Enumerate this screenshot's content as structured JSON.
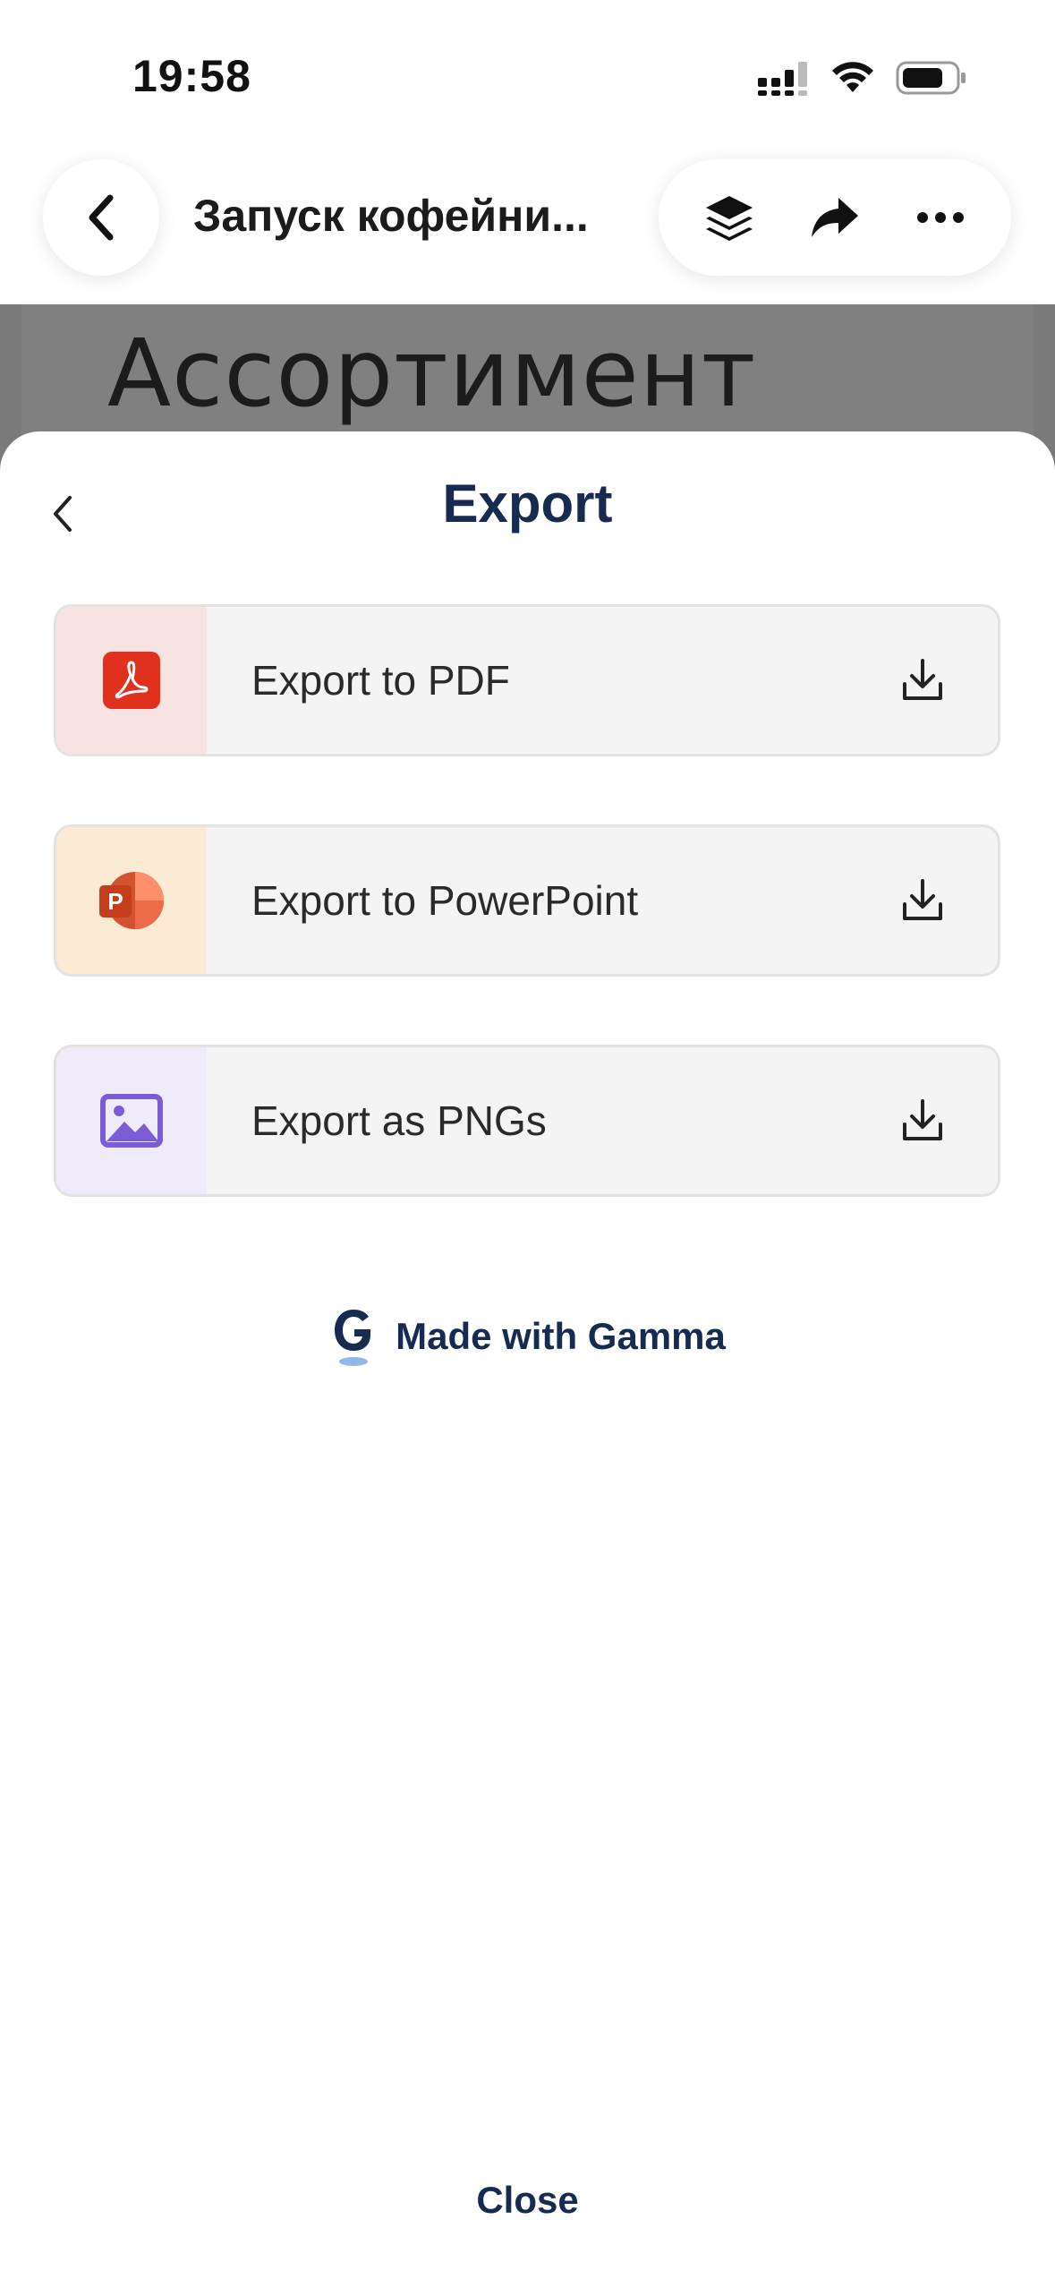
{
  "status_bar": {
    "time": "19:58",
    "icons": [
      "cellular-signal-icon",
      "wifi-icon",
      "battery-icon"
    ]
  },
  "top_nav": {
    "title": "Запуск кофейни...",
    "actions": [
      "layers-icon",
      "share-icon",
      "more-icon"
    ]
  },
  "backdrop": {
    "heading": "Ассортимент"
  },
  "sheet": {
    "title": "Export",
    "options": [
      {
        "label": "Export to PDF",
        "icon": "pdf-icon",
        "accent_bg": "#f8e3e3",
        "icon_color": "#e0301e"
      },
      {
        "label": "Export to PowerPoint",
        "icon": "powerpoint-icon",
        "accent_bg": "#fbebd5",
        "icon_color": "#d35230"
      },
      {
        "label": "Export as PNGs",
        "icon": "image-icon",
        "accent_bg": "#efebfb",
        "icon_color": "#7c5cd6"
      }
    ],
    "made_with": "Made with Gamma",
    "close_label": "Close"
  },
  "colors": {
    "brand_navy": "#172a4f",
    "backdrop_gray": "#7a7a7a"
  }
}
